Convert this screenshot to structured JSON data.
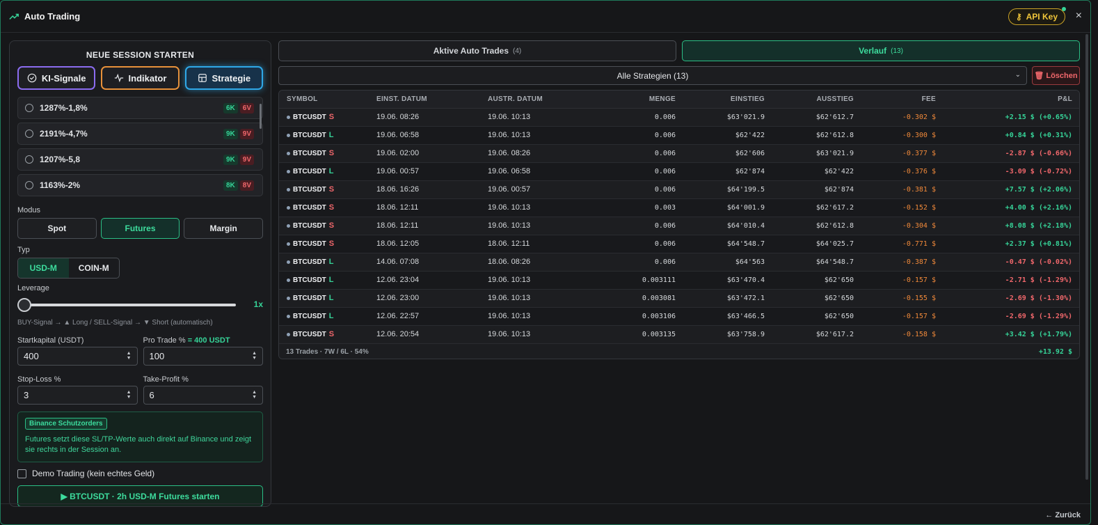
{
  "header": {
    "title": "Auto Trading",
    "api_key_label": "API Key",
    "close": "×"
  },
  "footer": {
    "back_label": "← Zurück"
  },
  "session": {
    "heading": "NEUE SESSION STARTEN",
    "sources": [
      {
        "label": "KI-Signale"
      },
      {
        "label": "Indikator"
      },
      {
        "label": "Strategie"
      }
    ],
    "strategies": [
      {
        "name": "1287%-1,8%",
        "k": "6K",
        "v": "6V"
      },
      {
        "name": "2191%-4,7%",
        "k": "9K",
        "v": "9V"
      },
      {
        "name": "1207%-5,8",
        "k": "9K",
        "v": "9V"
      },
      {
        "name": "1163%-2%",
        "k": "8K",
        "v": "8V"
      }
    ],
    "modus_label": "Modus",
    "modus": [
      "Spot",
      "Futures",
      "Margin"
    ],
    "typ_label": "Typ",
    "typ": [
      "USD-M",
      "COIN-M"
    ],
    "leverage_label": "Leverage",
    "leverage_value": "1x",
    "leverage_hint": "BUY-Signal → ▲ Long / SELL-Signal → ▼ Short (automatisch)",
    "startkapital_label": "Startkapital (USDT)",
    "startkapital_value": "400",
    "protrade_label": "Pro Trade %",
    "protrade_extra": "= 400 USDT",
    "protrade_value": "100",
    "stoploss_label": "Stop-Loss %",
    "stoploss_value": "3",
    "takeprofit_label": "Take-Profit %",
    "takeprofit_value": "6",
    "info_tag": "Binance Schutzorders",
    "info_text": "Futures setzt diese SL/TP-Werte auch direkt auf Binance und zeigt sie rechts in der Session an.",
    "demo_label": "Demo Trading (kein echtes Geld)",
    "start_label": "▶ BTCUSDT · 2h USD-M Futures starten"
  },
  "tabs": [
    {
      "label": "Aktive Auto Trades",
      "count": "(4)"
    },
    {
      "label": "Verlauf",
      "count": "(13)"
    }
  ],
  "filter": {
    "value": "Alle Strategien (13)",
    "delete_label": "Löschen"
  },
  "table": {
    "headers": [
      "SYMBOL",
      "EINST. DATUM",
      "AUSTR. DATUM",
      "MENGE",
      "EINSTIEG",
      "AUSSTIEG",
      "FEE",
      "P&L"
    ],
    "rows": [
      {
        "symbol": "BTCUSDT",
        "side": "S",
        "entry_date": "19.06. 08:26",
        "exit_date": "19.06. 10:13",
        "qty": "0.006",
        "entry": "$63'021.9",
        "exit": "$62'612.7",
        "fee": "-0.302 $",
        "pnl": "+2.15 $ (+0.65%)"
      },
      {
        "symbol": "BTCUSDT",
        "side": "L",
        "entry_date": "19.06. 06:58",
        "exit_date": "19.06. 10:13",
        "qty": "0.006",
        "entry": "$62'422",
        "exit": "$62'612.8",
        "fee": "-0.300 $",
        "pnl": "+0.84 $ (+0.31%)"
      },
      {
        "symbol": "BTCUSDT",
        "side": "S",
        "entry_date": "19.06. 02:00",
        "exit_date": "19.06. 08:26",
        "qty": "0.006",
        "entry": "$62'606",
        "exit": "$63'021.9",
        "fee": "-0.377 $",
        "pnl": "-2.87 $ (-0.66%)"
      },
      {
        "symbol": "BTCUSDT",
        "side": "L",
        "entry_date": "19.06. 00:57",
        "exit_date": "19.06. 06:58",
        "qty": "0.006",
        "entry": "$62'874",
        "exit": "$62'422",
        "fee": "-0.376 $",
        "pnl": "-3.09 $ (-0.72%)"
      },
      {
        "symbol": "BTCUSDT",
        "side": "S",
        "entry_date": "18.06. 16:26",
        "exit_date": "19.06. 00:57",
        "qty": "0.006",
        "entry": "$64'199.5",
        "exit": "$62'874",
        "fee": "-0.381 $",
        "pnl": "+7.57 $ (+2.06%)"
      },
      {
        "symbol": "BTCUSDT",
        "side": "S",
        "entry_date": "18.06. 12:11",
        "exit_date": "19.06. 10:13",
        "qty": "0.003",
        "entry": "$64'001.9",
        "exit": "$62'617.2",
        "fee": "-0.152 $",
        "pnl": "+4.00 $ (+2.16%)"
      },
      {
        "symbol": "BTCUSDT",
        "side": "S",
        "entry_date": "18.06. 12:11",
        "exit_date": "19.06. 10:13",
        "qty": "0.006",
        "entry": "$64'010.4",
        "exit": "$62'612.8",
        "fee": "-0.304 $",
        "pnl": "+8.08 $ (+2.18%)"
      },
      {
        "symbol": "BTCUSDT",
        "side": "S",
        "entry_date": "18.06. 12:05",
        "exit_date": "18.06. 12:11",
        "qty": "0.006",
        "entry": "$64'548.7",
        "exit": "$64'025.7",
        "fee": "-0.771 $",
        "pnl": "+2.37 $ (+0.81%)"
      },
      {
        "symbol": "BTCUSDT",
        "side": "L",
        "entry_date": "14.06. 07:08",
        "exit_date": "18.06. 08:26",
        "qty": "0.006",
        "entry": "$64'563",
        "exit": "$64'548.7",
        "fee": "-0.387 $",
        "pnl": "-0.47 $ (-0.02%)"
      },
      {
        "symbol": "BTCUSDT",
        "side": "L",
        "entry_date": "12.06. 23:04",
        "exit_date": "19.06. 10:13",
        "qty": "0.003111",
        "entry": "$63'470.4",
        "exit": "$62'650",
        "fee": "-0.157 $",
        "pnl": "-2.71 $ (-1.29%)"
      },
      {
        "symbol": "BTCUSDT",
        "side": "L",
        "entry_date": "12.06. 23:00",
        "exit_date": "19.06. 10:13",
        "qty": "0.003081",
        "entry": "$63'472.1",
        "exit": "$62'650",
        "fee": "-0.155 $",
        "pnl": "-2.69 $ (-1.30%)"
      },
      {
        "symbol": "BTCUSDT",
        "side": "L",
        "entry_date": "12.06. 22:57",
        "exit_date": "19.06. 10:13",
        "qty": "0.003106",
        "entry": "$63'466.5",
        "exit": "$62'650",
        "fee": "-0.157 $",
        "pnl": "-2.69 $ (-1.29%)"
      },
      {
        "symbol": "BTCUSDT",
        "side": "S",
        "entry_date": "12.06. 20:54",
        "exit_date": "19.06. 10:13",
        "qty": "0.003135",
        "entry": "$63'758.9",
        "exit": "$62'617.2",
        "fee": "-0.158 $",
        "pnl": "+3.42 $ (+1.79%)"
      }
    ],
    "summary": "13 Trades · 7W / 6L · 54%",
    "total": "+13.92 $"
  },
  "colors": {
    "accent": "#36d398",
    "negative": "#f0676b",
    "fee": "#f28a3a",
    "strategy": "#2fa8e8",
    "ki": "#8b6cf0",
    "indikator": "#e8913a",
    "apikey": "#f0c53a"
  }
}
